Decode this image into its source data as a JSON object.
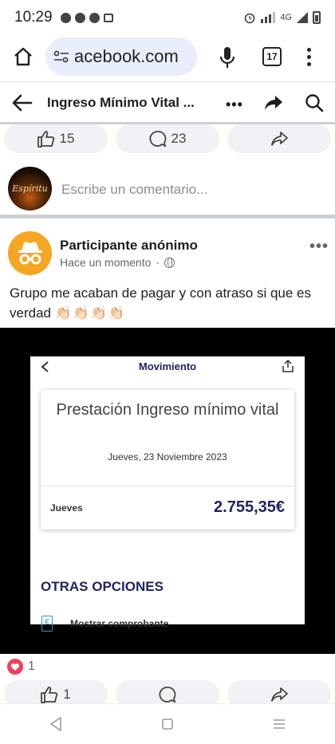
{
  "status_bar": {
    "time": "10:29",
    "network": "4G"
  },
  "browser": {
    "url": "acebook.com",
    "tab_count": "17"
  },
  "header": {
    "title": "Ingreso Mínimo Vital ...",
    "more": "•••"
  },
  "previous_post_actions": {
    "like_count": "15",
    "comment_count": "23"
  },
  "comment_box": {
    "avatar_text": "Espíritu",
    "placeholder": "Escribe un comentario..."
  },
  "post": {
    "author": "Participante anónimo",
    "time": "Hace un momento",
    "options": "•••",
    "text": "Grupo me acaban de pagar y con atraso si que es verdad",
    "emoji": "👏🏻👏🏻👏🏻👏🏻"
  },
  "embedded_screenshot": {
    "nav_title": "Movimiento",
    "card_title": "Prestación Ingreso mínimo vital",
    "date": "Jueves, 23 Noviembre 2023",
    "day": "Jueves",
    "amount": "2.755,35€",
    "section_title": "OTRAS OPCIONES",
    "show_receipt": "Mostrar comprobante",
    "doc_icon": "€"
  },
  "reactions": {
    "count": "1"
  },
  "post_actions": {
    "like_count": "1"
  },
  "colors": {
    "heart": "#f33e58",
    "accent_navy": "#1f2460",
    "avatar_orange": "#f5a623"
  }
}
